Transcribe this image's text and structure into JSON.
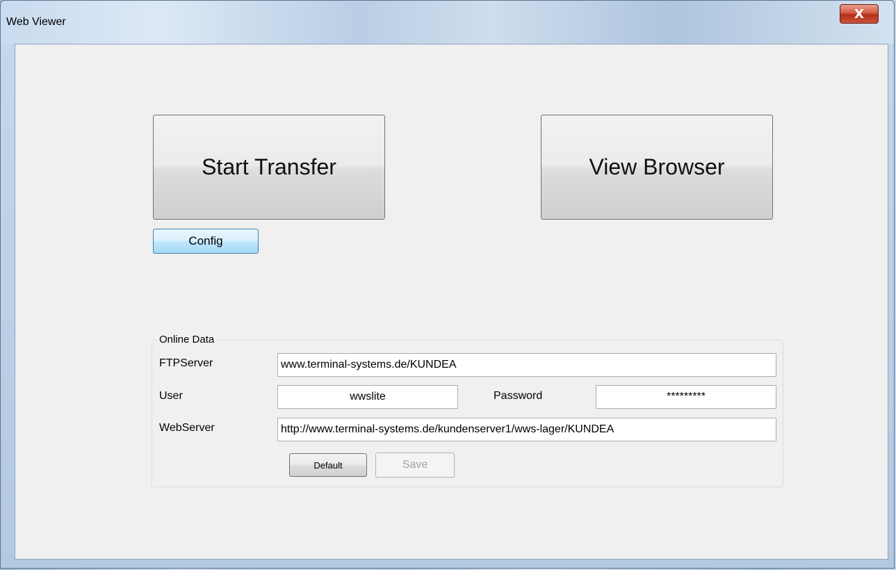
{
  "window": {
    "title": "Web Viewer",
    "close_label": "X"
  },
  "main": {
    "start_transfer_label": "Start Transfer",
    "view_browser_label": "View Browser",
    "config_label": "Config"
  },
  "online_data": {
    "legend": "Online Data",
    "ftp_label": "FTPServer",
    "ftp_value": "www.terminal-systems.de/KUNDEA",
    "user_label": "User",
    "user_value": "wwslite",
    "password_label": "Password",
    "password_value": "*********",
    "webserver_label": "WebServer",
    "webserver_value": "http://www.terminal-systems.de/kundenserver1/wws-lager/KUNDEA",
    "default_label": "Default",
    "save_label": "Save"
  }
}
